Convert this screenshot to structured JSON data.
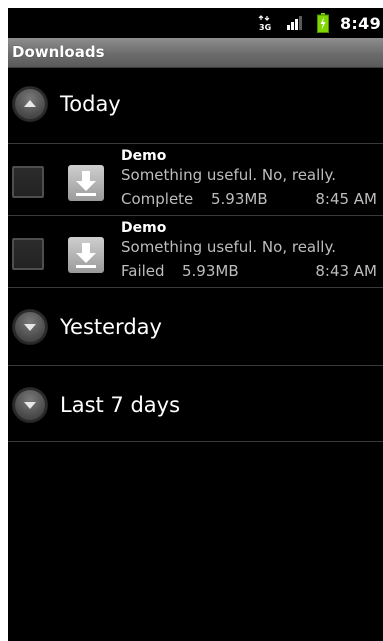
{
  "status_bar": {
    "network_type_icon": "3g-data-icon",
    "signal_icon": "signal-strength-icon",
    "battery_icon": "battery-charging-icon",
    "time": "8:49"
  },
  "title_bar": {
    "title": "Downloads"
  },
  "groups": [
    {
      "label": "Today",
      "expanded": true,
      "items": [
        {
          "title": "Demo",
          "description": "Something useful. No, really.",
          "status": "Complete",
          "size": "5.93MB",
          "time": "8:45 AM",
          "icon": "download-icon"
        },
        {
          "title": "Demo",
          "description": "Something useful. No, really.",
          "status": "Failed",
          "size": "5.93MB",
          "time": "8:43 AM",
          "icon": "download-icon"
        }
      ]
    },
    {
      "label": "Yesterday",
      "expanded": false,
      "items": []
    },
    {
      "label": "Last 7 days",
      "expanded": false,
      "items": []
    }
  ],
  "colors": {
    "background": "#000000",
    "title_bar": "#6c6c6c",
    "battery": "#7fd600",
    "secondary_text": "#bdbdbd",
    "divider": "#3b3b3b"
  }
}
